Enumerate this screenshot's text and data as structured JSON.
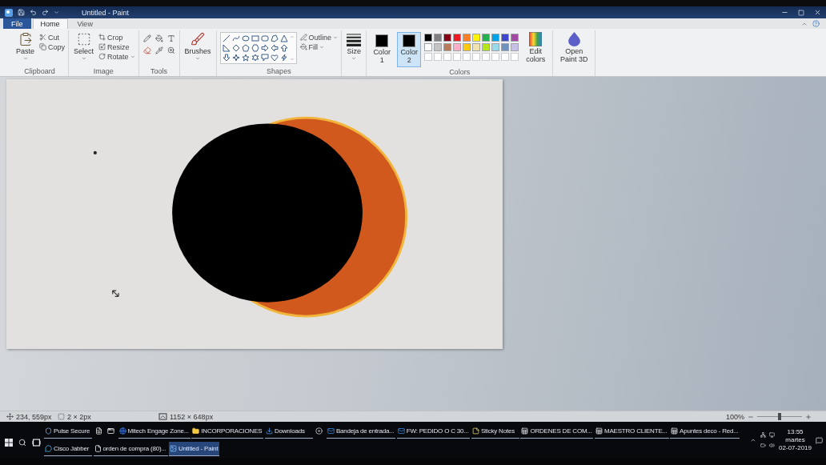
{
  "window": {
    "title": "Untitled - Paint"
  },
  "ribbon_tabs": [
    {
      "kind": "file",
      "label": "File",
      "selected": false
    },
    {
      "kind": "tab",
      "label": "Home",
      "selected": true
    },
    {
      "kind": "tab",
      "label": "View",
      "selected": false
    }
  ],
  "ribbon": {
    "clipboard": {
      "label": "Clipboard",
      "paste": "Paste",
      "cut": "Cut",
      "copy": "Copy"
    },
    "image": {
      "label": "Image",
      "select": "Select",
      "crop": "Crop",
      "resize": "Resize",
      "rotate": "Rotate"
    },
    "tools": {
      "label": "Tools"
    },
    "brushes": {
      "button": "Brushes"
    },
    "shapes": {
      "label": "Shapes",
      "outline": "Outline",
      "fill": "Fill"
    },
    "size": {
      "button": "Size"
    },
    "colors": {
      "label": "Colors",
      "color_1": {
        "label": "Color 1",
        "color": "#000000",
        "selected": false
      },
      "color_2": {
        "label": "Color 2",
        "color": "#000000",
        "selected": true
      },
      "palette": [
        {
          "color": "#000000"
        },
        {
          "color": "#7f7f7f"
        },
        {
          "color": "#880015"
        },
        {
          "color": "#ed1c24"
        },
        {
          "color": "#ff7f27"
        },
        {
          "color": "#fff200"
        },
        {
          "color": "#22b14c"
        },
        {
          "color": "#00a2e8"
        },
        {
          "color": "#3f48cc"
        },
        {
          "color": "#a349a4"
        },
        {
          "color": "#ffffff"
        },
        {
          "color": "#c3c3c3"
        },
        {
          "color": "#b97a57"
        },
        {
          "color": "#ffaec9"
        },
        {
          "color": "#ffc90e"
        },
        {
          "color": "#efe4b0"
        },
        {
          "color": "#b5e61d"
        },
        {
          "color": "#99d9ea"
        },
        {
          "color": "#7092be"
        },
        {
          "color": "#c8bfe7"
        }
      ],
      "edit_colors": "Edit colors"
    },
    "paint_3d": {
      "button": "Open Paint 3D"
    }
  },
  "status_bar": {
    "cursor_position": "234, 559px",
    "selection_size": "2 × 2px",
    "image_size": "1152 × 648px",
    "zoom": "100%",
    "zoom_slider": {
      "level": 0.5
    }
  },
  "taskbar": {
    "rows": [
      [
        {
          "kind": "shield",
          "label": "Pulse Secure",
          "selected": false
        },
        {
          "kind": "document",
          "selected": false
        },
        {
          "kind": "app",
          "selected": false
        },
        {
          "kind": "browser",
          "label": "Mitech Engage Zone...",
          "selected": false
        },
        {
          "kind": "folder",
          "label": "INCORPORACIONES",
          "selected": false
        },
        {
          "kind": "download",
          "label": "Downloads",
          "selected": false
        },
        {
          "kind": "disc",
          "selected": false
        },
        {
          "kind": "mail",
          "label": "Bandeja de entrada...",
          "selected": false
        },
        {
          "kind": "mail",
          "label": "FW: PEDIDO O C 30...",
          "selected": false
        },
        {
          "kind": "note",
          "label": "Sticky Notes",
          "selected": false
        },
        {
          "kind": "sheet",
          "label": "ORDENES DE COM...",
          "selected": false
        },
        {
          "kind": "sheet",
          "label": "MAESTRO CLIENTE...",
          "selected": false
        },
        {
          "kind": "sheet",
          "label": "Apuntes deco - Red...",
          "selected": false
        }
      ],
      [
        {
          "kind": "chat",
          "label": "Cisco Jabber",
          "selected": false
        },
        {
          "kind": "pdf",
          "label": "orden de compra (80)...",
          "selected": false
        },
        {
          "kind": "paint",
          "label": "Untitled - Paint",
          "selected": true
        }
      ]
    ],
    "clock": {
      "time": "13:55",
      "day": "martes",
      "date": "02-07-2019"
    }
  }
}
